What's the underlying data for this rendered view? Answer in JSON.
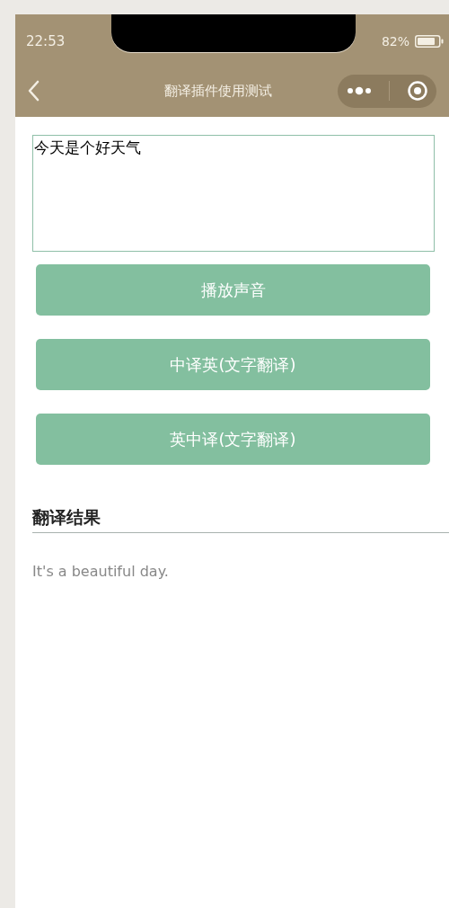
{
  "status_bar": {
    "time": "22:53",
    "battery": "82%"
  },
  "nav_bar": {
    "title": "翻译插件使用测试"
  },
  "input": {
    "value": "今天是个好天气"
  },
  "buttons": [
    "播放声音",
    "中译英(文字翻译)",
    "英中译(文字翻译)"
  ],
  "result": {
    "heading": "翻译结果",
    "text": "It's a beautiful day."
  }
}
